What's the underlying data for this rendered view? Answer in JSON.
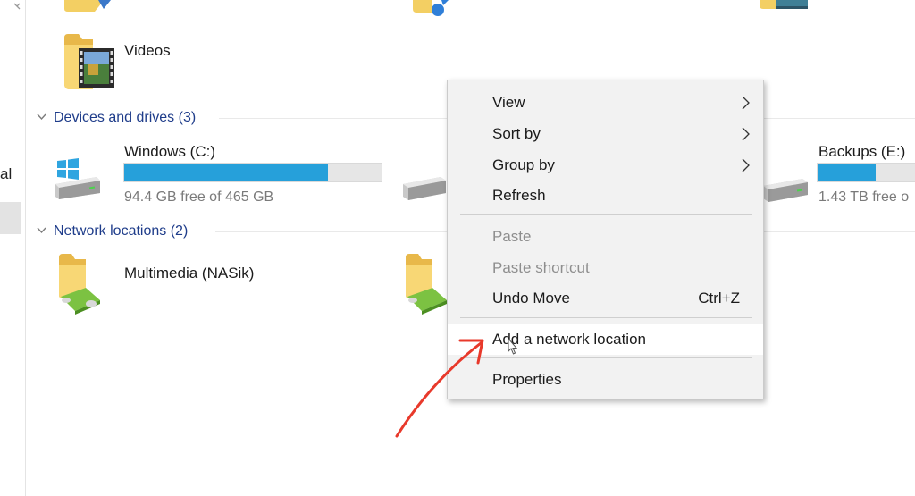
{
  "nav": {
    "partial_label": "al"
  },
  "folders": {
    "videos_label": "Videos"
  },
  "devices": {
    "header": "Devices and drives (3)",
    "drives": [
      {
        "name": "Windows (C:)",
        "free_text": "94.4 GB free of 465 GB",
        "used_fraction": 0.79
      },
      {
        "name": "",
        "free_text": "",
        "used_fraction": null
      },
      {
        "name": "Backups (E:)",
        "free_text": "1.43 TB free o",
        "used_fraction": 0.55
      }
    ]
  },
  "network": {
    "header": "Network locations (2)",
    "locations": [
      {
        "name": "Multimedia (NASik)"
      }
    ]
  },
  "context_menu": {
    "items": [
      {
        "label": "View",
        "submenu": true
      },
      {
        "label": "Sort by",
        "submenu": true
      },
      {
        "label": "Group by",
        "submenu": true
      },
      {
        "label": "Refresh"
      },
      {
        "label": "Paste",
        "disabled": true
      },
      {
        "label": "Paste shortcut",
        "disabled": true
      },
      {
        "label": "Undo Move",
        "shortcut": "Ctrl+Z"
      },
      {
        "label": "Add a network location",
        "highlighted": true
      },
      {
        "label": "Properties"
      }
    ]
  },
  "colors": {
    "accent_bar": "#26a0da",
    "group_header": "#1e3c8a",
    "annotation_arrow": "#e8392b",
    "menu_background": "#f2f2f2"
  }
}
